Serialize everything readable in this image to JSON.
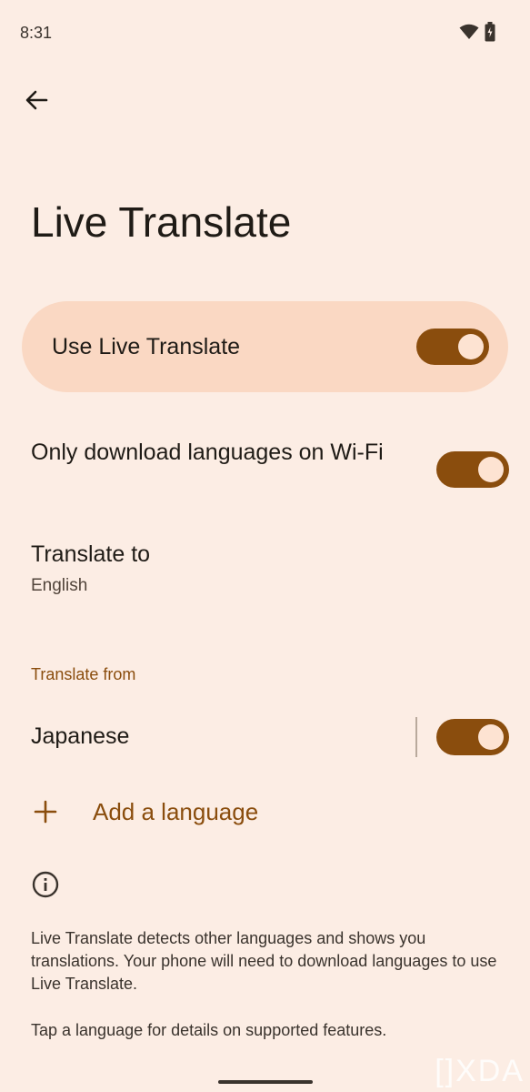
{
  "status_bar": {
    "time": "8:31",
    "icons": [
      "wifi-icon",
      "battery-icon"
    ]
  },
  "header": {
    "back_icon": "arrow-left-icon",
    "title": "Live Translate"
  },
  "main_toggle": {
    "label": "Use Live Translate",
    "on": true
  },
  "settings": {
    "wifi_only": {
      "label": "Only download languages on Wi-Fi",
      "on": true
    },
    "translate_to": {
      "label": "Translate to",
      "value": "English"
    }
  },
  "translate_from": {
    "header": "Translate from",
    "languages": [
      {
        "name": "Japanese",
        "on": true
      }
    ],
    "add_label": "Add a language"
  },
  "info": {
    "icon": "info-icon",
    "paragraph1": "Live Translate detects other languages and shows you translations. Your phone will need to download languages to use Live Translate.",
    "paragraph2": "Tap a language for details on supported features."
  },
  "watermark": "[]XDA",
  "colors": {
    "background": "#fcede4",
    "card": "#fad8c3",
    "accent": "#8a4d0d",
    "thumb": "#fde3d2"
  }
}
